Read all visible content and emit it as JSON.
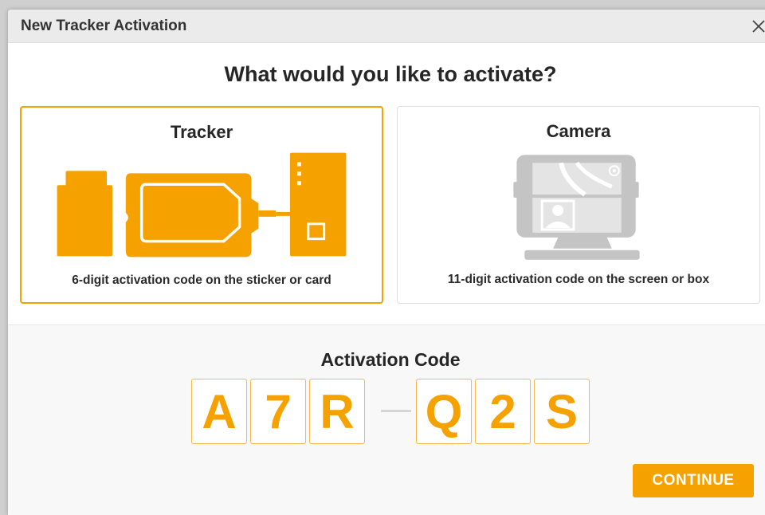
{
  "dialog": {
    "title": "New Tracker Activation",
    "close_icon": "close-icon"
  },
  "heading": "What would you like to activate?",
  "options": [
    {
      "title": "Tracker",
      "description": "6-digit activation code on the sticker or card",
      "selected": true,
      "icon": "tracker-devices-icon"
    },
    {
      "title": "Camera",
      "description": "11-digit activation code on the screen or box",
      "selected": false,
      "icon": "dash-camera-icon"
    }
  ],
  "activation": {
    "label": "Activation Code",
    "digits": [
      "A",
      "7",
      "R",
      "Q",
      "2",
      "S"
    ]
  },
  "continue_label": "CONTINUE",
  "colors": {
    "accent": "#f5a100",
    "camera_gray": "#c4c4c4"
  }
}
